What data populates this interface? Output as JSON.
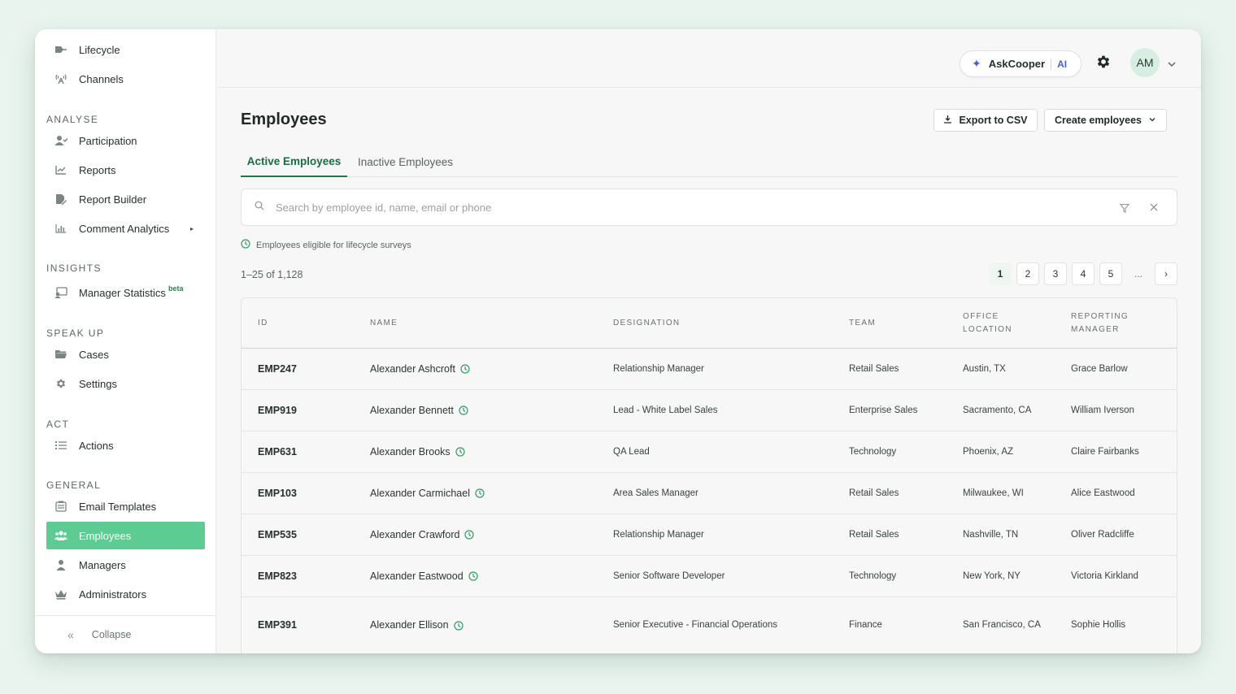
{
  "sidebar": {
    "items_top": [
      {
        "label": "Lifecycle",
        "icon": "lifecycle-icon"
      },
      {
        "label": "Channels",
        "icon": "broadcast-icon"
      }
    ],
    "sections": [
      {
        "title": "ANALYSE",
        "items": [
          {
            "label": "Participation",
            "icon": "user-check-icon"
          },
          {
            "label": "Reports",
            "icon": "line-chart-icon"
          },
          {
            "label": "Report Builder",
            "icon": "file-edit-icon"
          },
          {
            "label": "Comment Analytics",
            "icon": "bar-chart-icon"
          }
        ]
      },
      {
        "title": "INSIGHTS",
        "items": [
          {
            "label": "Manager Statistics",
            "badge": "beta",
            "icon": "presentation-icon"
          }
        ]
      },
      {
        "title": "SPEAK UP",
        "items": [
          {
            "label": "Cases",
            "icon": "folder-icon"
          },
          {
            "label": "Settings",
            "icon": "gear-icon"
          }
        ]
      },
      {
        "title": "ACT",
        "items": [
          {
            "label": "Actions",
            "icon": "list-icon"
          }
        ]
      },
      {
        "title": "GENERAL",
        "items": [
          {
            "label": "Email Templates",
            "icon": "email-template-icon"
          },
          {
            "label": "Employees",
            "icon": "users-icon",
            "active": true
          },
          {
            "label": "Managers",
            "icon": "user-icon"
          },
          {
            "label": "Administrators",
            "icon": "crown-icon"
          }
        ]
      }
    ],
    "collapse_label": "Collapse"
  },
  "header": {
    "ask_label": "AskCooper",
    "ask_ai": "AI",
    "avatar_initials": "AM"
  },
  "main": {
    "title": "Employees",
    "export_label": "Export to CSV",
    "create_label": "Create employees",
    "tabs": [
      "Active Employees",
      "Inactive Employees"
    ],
    "search_placeholder": "Search by employee id, name, email or phone",
    "eligible_note": "Employees eligible for lifecycle surveys",
    "count": "1–25 of 1,128",
    "pages": [
      "1",
      "2",
      "3",
      "4",
      "5",
      "...",
      "›"
    ],
    "current_page": "1"
  },
  "table": {
    "headers": {
      "id": "ID",
      "name": "NAME",
      "designation": "DESIGNATION",
      "team": "TEAM",
      "office_1": "OFFICE",
      "office_2": "LOCATION",
      "manager_1": "REPORTING",
      "manager_2": "MANAGER"
    },
    "rows": [
      {
        "id": "EMP247",
        "name": "Alexander Ashcroft",
        "designation": "Relationship Manager",
        "team": "Retail Sales",
        "office": "Austin, TX",
        "manager": "Grace Barlow"
      },
      {
        "id": "EMP919",
        "name": "Alexander Bennett",
        "designation": "Lead - White Label Sales",
        "team": "Enterprise Sales",
        "office": "Sacramento, CA",
        "manager": "William Iverson"
      },
      {
        "id": "EMP631",
        "name": "Alexander Brooks",
        "designation": "QA Lead",
        "team": "Technology",
        "office": "Phoenix, AZ",
        "manager": "Claire Fairbanks"
      },
      {
        "id": "EMP103",
        "name": "Alexander Carmichael",
        "designation": "Area Sales Manager",
        "team": "Retail Sales",
        "office": "Milwaukee, WI",
        "manager": "Alice Eastwood"
      },
      {
        "id": "EMP535",
        "name": "Alexander Crawford",
        "designation": "Relationship Manager",
        "team": "Retail Sales",
        "office": "Nashville, TN",
        "manager": "Oliver Radcliffe"
      },
      {
        "id": "EMP823",
        "name": "Alexander Eastwood",
        "designation": "Senior Software Developer",
        "team": "Technology",
        "office": "New York, NY",
        "manager": "Victoria Kirkland"
      },
      {
        "id": "EMP391",
        "name": "Alexander Ellison",
        "designation": "Senior Executive - Financial Operations",
        "team": "Finance",
        "office": "San Francisco, CA",
        "manager": "Sophie Hollis"
      }
    ]
  },
  "colors": {
    "accent": "#5ccc92",
    "tab_active": "#1b7a4b",
    "ai": "#4c5cd8"
  }
}
